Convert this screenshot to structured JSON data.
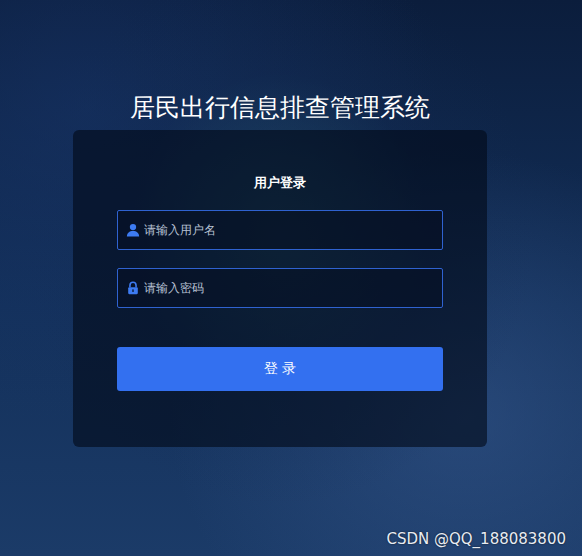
{
  "title": "居民出行信息排查管理系统",
  "login_form": {
    "heading": "用户登录",
    "fields": [
      {
        "placeholder": "请输入用户名",
        "kind": "user"
      },
      {
        "placeholder": "请输入密码",
        "kind": "password"
      }
    ],
    "button": "登 录"
  },
  "watermark": "CSDN @QQ_188083800"
}
